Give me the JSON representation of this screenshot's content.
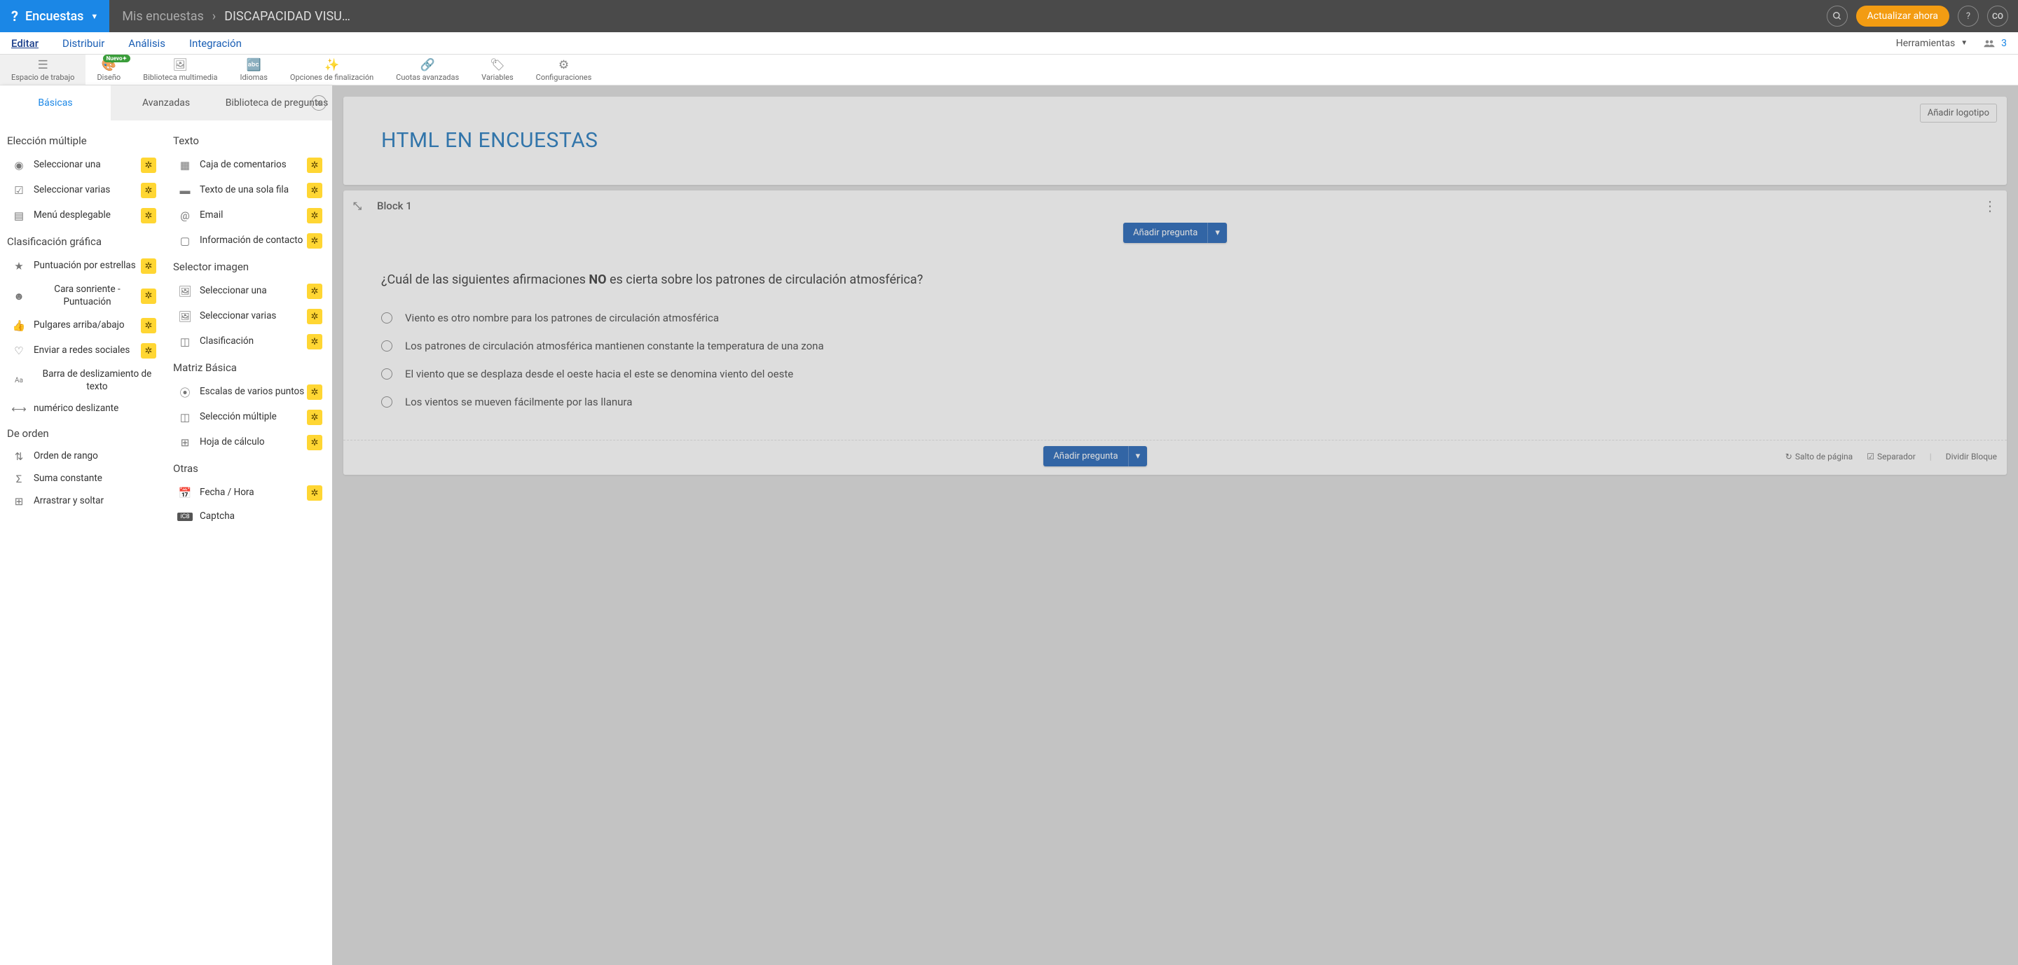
{
  "header": {
    "brand": "Encuestas",
    "breadcrumb_parent": "Mis encuestas",
    "breadcrumb_current": "DISCAPACIDAD VISU…",
    "update_btn": "Actualizar ahora",
    "avatar": "CO",
    "help": "?"
  },
  "nav": {
    "tabs": [
      "Editar",
      "Distribuir",
      "Análisis",
      "Integración"
    ],
    "herramientas": "Herramientas",
    "share_count": "3"
  },
  "toolbar": {
    "workspace": "Espacio de trabajo",
    "design": "Diseño",
    "nuevo": "Nuevo✦",
    "media": "Biblioteca multimedia",
    "languages": "Idiomas",
    "completion": "Opciones de finalización",
    "quotas": "Cuotas avanzadas",
    "variables": "Variables",
    "config": "Configuraciones"
  },
  "sidebar": {
    "tabs": {
      "basic": "Básicas",
      "advanced": "Avanzadas",
      "library": "Biblioteca de preguntas"
    },
    "sections": {
      "multiple_choice": "Elección múltiple",
      "graphic_rating": "Clasificación gráfica",
      "ordering": "De orden",
      "text": "Texto",
      "image_selector": "Selector imagen",
      "basic_matrix": "Matriz Básica",
      "others": "Otras"
    },
    "items": {
      "select_one": "Seleccionar una",
      "select_many": "Seleccionar varias",
      "dropdown": "Menú desplegable",
      "star_rating": "Puntuación por estrellas",
      "smiley": "Cara sonriente - Puntuación",
      "thumbs": "Pulgares arriba/abajo",
      "push_social": "Enviar a redes sociales",
      "text_slider": "Barra de deslizamiento de texto",
      "numeric_slider": "numérico deslizante",
      "rank_order": "Orden de rango",
      "constant_sum": "Suma constante",
      "drag_drop": "Arrastrar y soltar",
      "comment_box": "Caja de comentarios",
      "single_row_text": "Texto de una sola fila",
      "email": "Email",
      "contact_info": "Información de contacto",
      "img_select_one": "Seleccionar una",
      "img_select_many": "Seleccionar varias",
      "img_rating": "Clasificación",
      "multi_point": "Escalas de varios puntos",
      "matrix_multiple": "Selección múltiple",
      "spreadsheet": "Hoja de cálculo",
      "date_time": "Fecha / Hora",
      "captcha": "Captcha"
    }
  },
  "canvas": {
    "add_logo": "Añadir logotipo",
    "survey_title": "HTML EN ENCUESTAS",
    "block_title": "Block 1",
    "add_question": "Añadir pregunta",
    "question": {
      "prefix": "¿Cuál de las siguientes afirmaciones ",
      "bold": "NO",
      "suffix": " es cierta sobre los patrones de circulación atmosférica?",
      "options": [
        "Viento es otro nombre para los patrones de circulación atmosférica",
        "Los patrones de circulación atmosférica mantienen constante la temperatura de una zona",
        "El viento que se desplaza desde el oeste hacia el este se denomina viento del oeste",
        "Los vientos se mueven fácilmente por las llanura"
      ]
    },
    "footer": {
      "page_break": "Salto de página",
      "separator": "Separador",
      "split_block": "Dividir Bloque"
    }
  }
}
